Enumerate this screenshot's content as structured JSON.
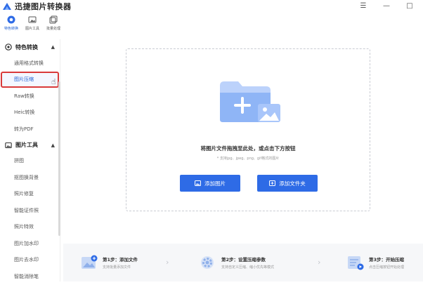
{
  "window": {
    "title": "迅捷图片转换器",
    "controls": [
      "☰",
      "—",
      "□"
    ]
  },
  "topnav": {
    "items": [
      {
        "label": "特色转换"
      },
      {
        "label": "图片工具"
      },
      {
        "label": "批量处理"
      }
    ]
  },
  "sidebar": {
    "sections": [
      {
        "title": "特色转换",
        "items": [
          "通用格式转换",
          "图片压缩",
          "Raw转换",
          "Heic转换",
          "转为PDF"
        ]
      },
      {
        "title": "图片工具",
        "items": [
          "拼图",
          "抠图换背景",
          "照片修复",
          "智能证件照",
          "照片特效",
          "图片加水印",
          "图片去水印",
          "智能消除笔"
        ]
      }
    ],
    "active_item": "图片压缩"
  },
  "dropzone": {
    "title": "将图片文件拖拽至此处，或点击下方按钮",
    "subtitle": "* 支持jpg、jpeg、png、gif格式的图片",
    "add_image_label": "添加图片",
    "add_folder_label": "添加文件夹"
  },
  "steps": [
    {
      "title": "第1步：添加文件",
      "desc": "支持批量添加文件"
    },
    {
      "title": "第2步：设置压缩参数",
      "desc": "支持自定义压缩、缩小优先等模式"
    },
    {
      "title": "第3步：开始压缩",
      "desc": "点击压缩按钮开始处理"
    }
  ],
  "colors": {
    "accent": "#2e6be6",
    "highlight_border": "#d93a3a",
    "text_primary": "#333333"
  }
}
